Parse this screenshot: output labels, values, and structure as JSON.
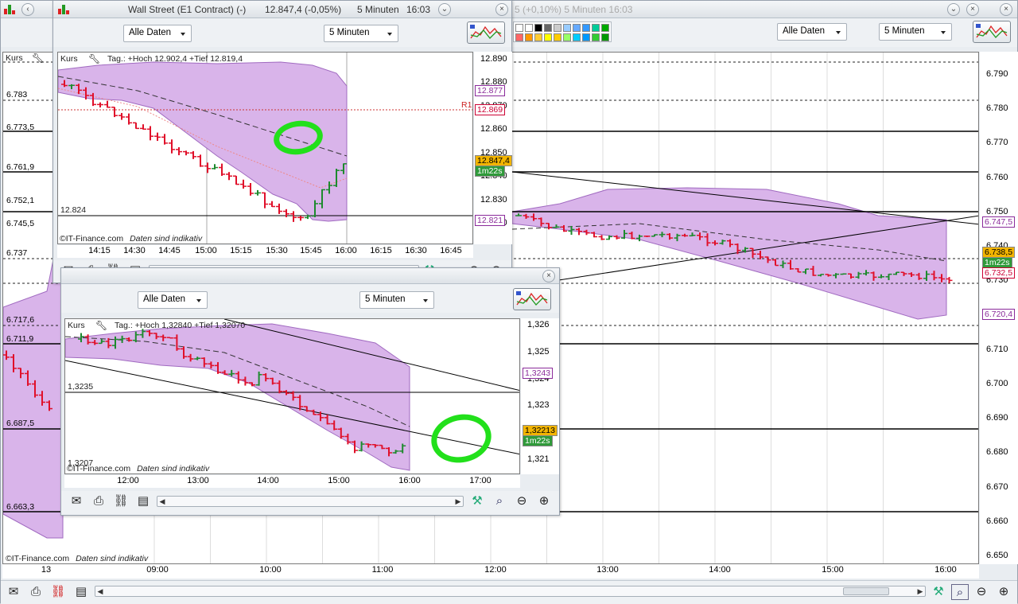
{
  "background_window": {
    "title_fragment": "5 (+0,10%)   5 Minuten  16:03",
    "period_select": "Alle Daten",
    "interval_select": "5 Minuten",
    "legend": "Kurs",
    "y_ticks": [
      "6.790",
      "6.780",
      "6.770",
      "6.760",
      "6.750",
      "6.740",
      "6.730",
      "6.720",
      "6.710",
      "6.700",
      "6.690",
      "6.680",
      "6.670",
      "6.660",
      "6.650"
    ],
    "left_tags": [
      "6.783",
      "6.773,5",
      "6.761,9",
      "6.752,1",
      "6.745,5",
      "6.737",
      "6.717,6",
      "6.711,9",
      "6.687,5",
      "6.663,3"
    ],
    "x_ticks": [
      "13",
      "09:00",
      "10:00",
      "11:00",
      "12:00",
      "13:00",
      "14:00",
      "15:00",
      "16:00"
    ],
    "price_tags": {
      "t1": "6.747,5",
      "last": "6.738,5",
      "countdown": "1m22s",
      "t2": "6.732,5",
      "t3": "6.720,4"
    },
    "footer_source": "©IT-Finance.com",
    "footer_note": "Daten sind indikativ"
  },
  "window_wallstreet": {
    "title": "Wall Street (E1 Contract) (-)",
    "title_price": "12.847,4 (-0,05%)",
    "title_interval": "5 Minuten",
    "title_time": "16:03",
    "period_select": "Alle Daten",
    "interval_select": "5 Minuten",
    "legend_kurs": "Kurs",
    "legend_detail": "Tag.: +Hoch 12.902,4 +Tief 12.819,4",
    "level_label": "12.824",
    "r1_label": "R1",
    "y_ticks": [
      "12.890",
      "12.880",
      "12.870",
      "12.860",
      "12.850",
      "12.840",
      "12.830",
      "12.820"
    ],
    "price_tags": {
      "a": "12.877",
      "b": "12.869",
      "last": "12.847,4",
      "countdown": "1m22s",
      "c": "12.821"
    },
    "x_ticks": [
      "14:15",
      "14:30",
      "14:45",
      "15:00",
      "15:15",
      "15:30",
      "15:45",
      "16:00",
      "16:15",
      "16:30",
      "16:45"
    ],
    "footer_source": "©IT-Finance.com",
    "footer_note": "Daten sind indikativ"
  },
  "window_eurusd": {
    "period_select": "Alle Daten",
    "interval_select": "5 Minuten",
    "legend_kurs": "Kurs",
    "legend_detail": "Tag.: +Hoch 1,32840 +Tief 1,32070",
    "level_label_1": "1,3235",
    "level_label_2": "1,3207",
    "y_ticks": [
      "1,326",
      "1,325",
      "1,324",
      "1,323",
      "1,322",
      "1,321"
    ],
    "price_tags": {
      "a": "1,3243",
      "last": "1,32213",
      "countdown": "1m22s"
    },
    "x_ticks": [
      "12:00",
      "13:00",
      "14:00",
      "15:00",
      "16:00",
      "17:00"
    ],
    "footer_source": "©IT-Finance.com",
    "footer_note": "Daten sind indikativ"
  },
  "colors": {
    "up": "#1e8a2e",
    "down": "#e0102a",
    "band": "#d9b4ea",
    "band_stroke": "#a06ac0",
    "circle": "#22e01b",
    "last_tag": "#f2b400",
    "count_tag": "#2f9a3a"
  },
  "icons": [
    "mail-icon",
    "print-icon",
    "link-icon",
    "clipboard-icon",
    "chart-settings-icon",
    "zoom-fit-icon",
    "zoom-out-icon",
    "zoom-in-icon",
    "chart-type-icon"
  ]
}
